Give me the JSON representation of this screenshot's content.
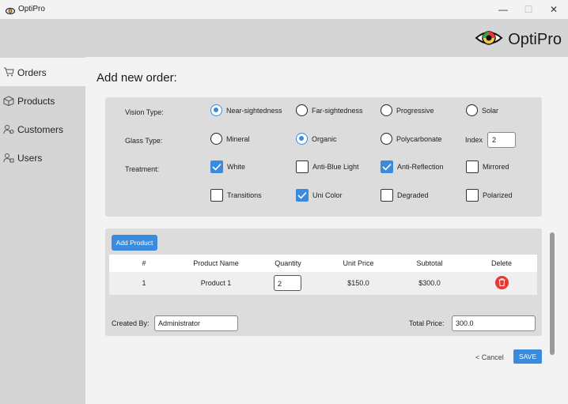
{
  "window": {
    "title": "OptiPro",
    "minimize": "—",
    "maximize": "☐",
    "close": "✕"
  },
  "brand": {
    "name": "OptiPro"
  },
  "sidebar": {
    "items": [
      {
        "label": "Orders",
        "icon": "cart-icon"
      },
      {
        "label": "Products",
        "icon": "box-icon"
      },
      {
        "label": "Customers",
        "icon": "customers-icon"
      },
      {
        "label": "Users",
        "icon": "users-icon"
      }
    ]
  },
  "page": {
    "title": "Add new order:"
  },
  "options": {
    "vision_type": {
      "label": "Vision Type:",
      "choices": [
        "Near-sightedness",
        "Far-sightedness",
        "Progressive",
        "Solar"
      ],
      "selected": "Near-sightedness"
    },
    "glass_type": {
      "label": "Glass Type:",
      "choices": [
        "Mineral",
        "Organic",
        "Polycarbonate"
      ],
      "selected": "Organic"
    },
    "index": {
      "label": "Index",
      "value": "2"
    },
    "treatment": {
      "label": "Treatment:",
      "choices": [
        {
          "label": "White",
          "checked": true
        },
        {
          "label": "Anti-Blue Light",
          "checked": false
        },
        {
          "label": "Anti-Reflection",
          "checked": true
        },
        {
          "label": "Mirrored",
          "checked": false
        },
        {
          "label": "Transitions",
          "checked": false
        },
        {
          "label": "Uni Color",
          "checked": true
        },
        {
          "label": "Degraded",
          "checked": false
        },
        {
          "label": "Polarized",
          "checked": false
        }
      ]
    }
  },
  "products": {
    "add_label": "Add Product",
    "columns": [
      "#",
      "Product Name",
      "Quantity",
      "Unit Price",
      "Subtotal",
      "Delete"
    ],
    "rows": [
      {
        "num": "1",
        "name": "Product 1",
        "quantity": "2",
        "unit_price": "$150.0",
        "subtotal": "$300.0"
      }
    ]
  },
  "footer": {
    "created_by_label": "Created By:",
    "created_by_value": "Administrator",
    "total_label": "Total Price:",
    "total_value": "300.0"
  },
  "actions": {
    "cancel": "< Cancel",
    "save": "SAVE"
  },
  "colors": {
    "accent": "#3a8bdd",
    "delete": "#e53935",
    "panel": "#dcdcdc",
    "sidebar": "#d5d5d5"
  }
}
